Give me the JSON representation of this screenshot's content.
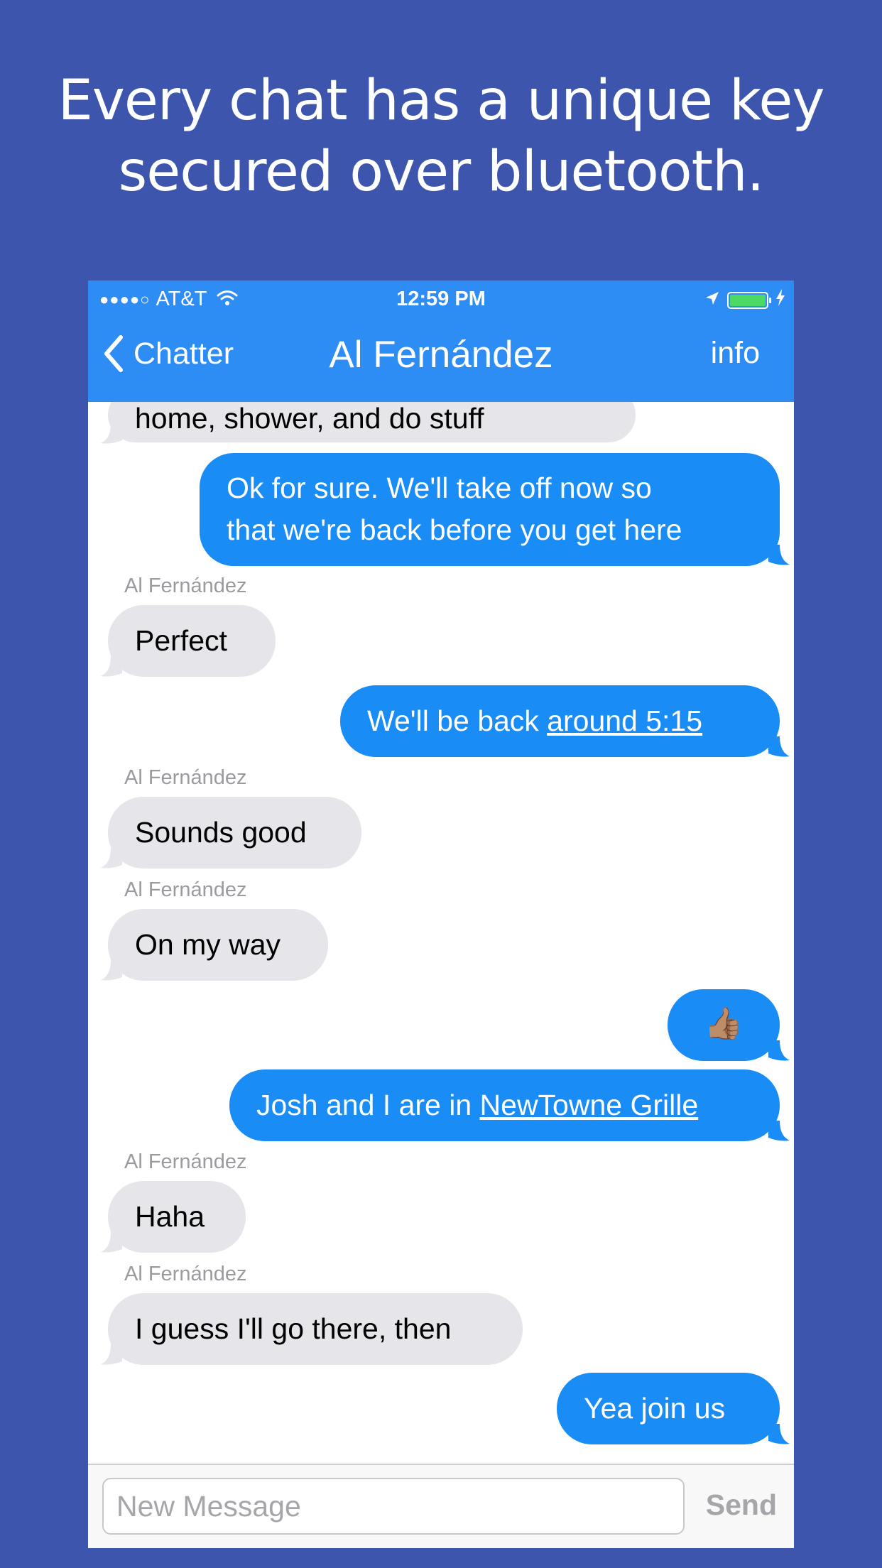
{
  "headline": {
    "line1": "Every chat has a unique key",
    "line2": "secured over bluetooth."
  },
  "status_bar": {
    "signal": "●●●●○",
    "carrier": "AT&T",
    "time": "12:59 PM"
  },
  "nav": {
    "back_label": "Chatter",
    "title": "Al Fernández",
    "info_label": "info"
  },
  "messages": [
    {
      "direction": "incoming",
      "text": "home, shower, and do stuff"
    },
    {
      "direction": "outgoing",
      "lines": [
        "Ok for sure.  We'll take off now so",
        "that we're back before you get here"
      ]
    },
    {
      "direction": "incoming",
      "sender": "Al Fernández",
      "text": "Perfect"
    },
    {
      "direction": "outgoing",
      "text_prefix": "We'll be back ",
      "link": "around 5:15"
    },
    {
      "direction": "incoming",
      "sender": "Al Fernández",
      "text": "Sounds good"
    },
    {
      "direction": "incoming",
      "sender": "Al Fernández",
      "text": "On my way"
    },
    {
      "direction": "outgoing",
      "text": "👍🏽"
    },
    {
      "direction": "outgoing",
      "text_prefix": "Josh and I are in ",
      "link": "NewTowne Grille"
    },
    {
      "direction": "incoming",
      "sender": "Al Fernández",
      "text": "Haha"
    },
    {
      "direction": "incoming",
      "sender": "Al Fernández",
      "text": "I guess I'll go there, then"
    },
    {
      "direction": "outgoing",
      "text": "Yea join us"
    }
  ],
  "composer": {
    "placeholder": "New Message",
    "send_label": "Send"
  },
  "colors": {
    "background": "#3d55ac",
    "nav_bar": "#2e8df5",
    "outgoing_bubble": "#1a8cf6",
    "incoming_bubble": "#e5e5ea",
    "battery": "#4cd964"
  },
  "icons": [
    "back-chevron-icon",
    "wifi-icon",
    "location-arrow-icon",
    "battery-icon",
    "charging-bolt-icon"
  ]
}
